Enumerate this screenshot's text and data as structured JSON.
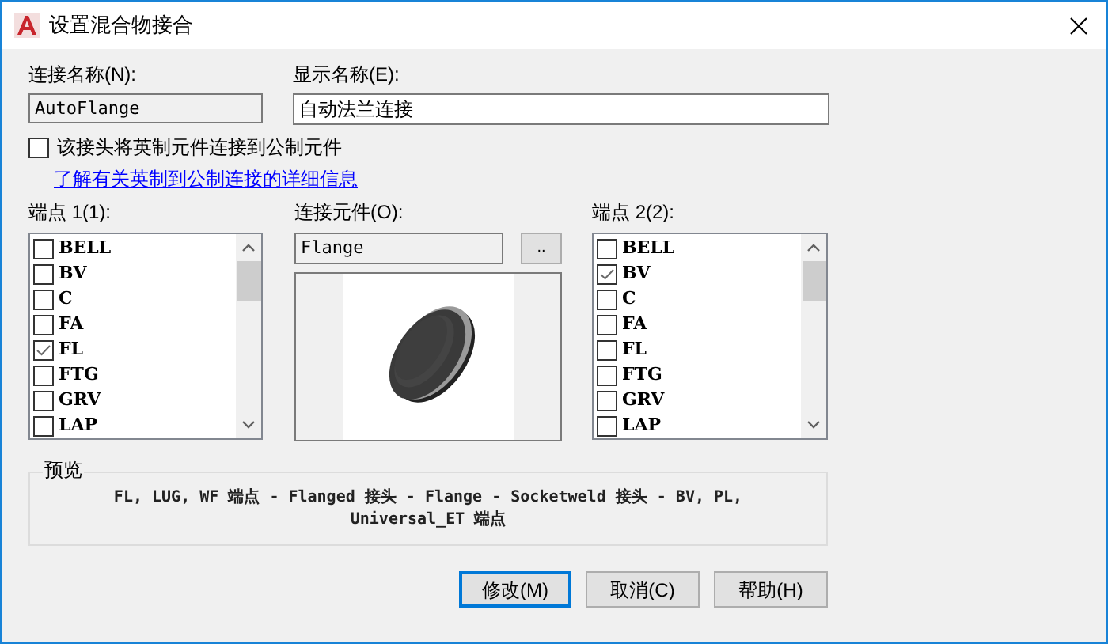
{
  "window": {
    "title": "设置混合物接合"
  },
  "connection_name": {
    "label": "连接名称(N):",
    "value": "AutoFlange"
  },
  "display_name": {
    "label": "显示名称(E):",
    "value": "自动法兰连接"
  },
  "imperial_to_metric": {
    "label": "该接头将英制元件连接到公制元件",
    "checked": false
  },
  "info_link": "了解有关英制到公制连接的详细信息",
  "endpoint_1": {
    "label": "端点 1(1):",
    "items": [
      {
        "label": "BELL",
        "checked": false
      },
      {
        "label": "BV",
        "checked": false
      },
      {
        "label": "C",
        "checked": false
      },
      {
        "label": "FA",
        "checked": false
      },
      {
        "label": "FL",
        "checked": true
      },
      {
        "label": "FTG",
        "checked": false
      },
      {
        "label": "GRV",
        "checked": false
      },
      {
        "label": "LAP",
        "checked": false
      }
    ]
  },
  "connection_part": {
    "label": "连接元件(O):",
    "value": "Flange",
    "browse_button": ".."
  },
  "endpoint_2": {
    "label": "端点 2(2):",
    "items": [
      {
        "label": "BELL",
        "checked": false
      },
      {
        "label": "BV",
        "checked": true
      },
      {
        "label": "C",
        "checked": false
      },
      {
        "label": "FA",
        "checked": false
      },
      {
        "label": "FL",
        "checked": false
      },
      {
        "label": "FTG",
        "checked": false
      },
      {
        "label": "GRV",
        "checked": false
      },
      {
        "label": "LAP",
        "checked": false
      }
    ]
  },
  "preview": {
    "label": "预览",
    "text": "FL, LUG, WF 端点 - Flanged 接头 - Flange - Socketweld 接头 - BV, PL, Universal_ET 端点"
  },
  "buttons": [
    {
      "label": "修改(M)",
      "default": true
    },
    {
      "label": "取消(C)",
      "default": false
    },
    {
      "label": "帮助(H)",
      "default": false
    }
  ]
}
